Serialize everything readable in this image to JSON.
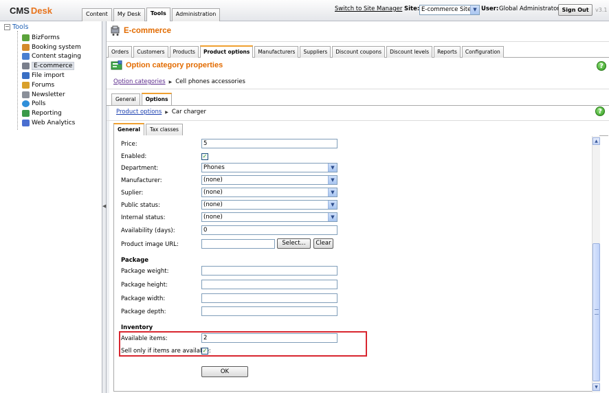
{
  "header": {
    "logo_cms": "CMS",
    "logo_desk": "Desk",
    "tabs": [
      {
        "label": "Content",
        "active": false
      },
      {
        "label": "My Desk",
        "active": false
      },
      {
        "label": "Tools",
        "active": true
      },
      {
        "label": "Administration",
        "active": false
      }
    ],
    "switch_link": "Switch to Site Manager",
    "site_label": "Site:",
    "site_value": "E-commerce Site",
    "user_label": "User:",
    "user_name": "Global Administrator",
    "sign_out": "Sign Out",
    "version": "v3.1"
  },
  "tree": {
    "root": "Tools",
    "items": [
      {
        "label": "BizForms",
        "icon": "bizforms-icon",
        "color": "#5ba33b",
        "selected": false
      },
      {
        "label": "Booking system",
        "icon": "booking-icon",
        "color": "#d48a2a",
        "selected": false
      },
      {
        "label": "Content staging",
        "icon": "staging-icon",
        "color": "#4a7fd0",
        "selected": false
      },
      {
        "label": "E-commerce",
        "icon": "ecommerce-icon",
        "color": "#7a7f8c",
        "selected": true
      },
      {
        "label": "File import",
        "icon": "file-import-icon",
        "color": "#3a6fc4",
        "selected": false
      },
      {
        "label": "Forums",
        "icon": "forums-icon",
        "color": "#d9a02a",
        "selected": false
      },
      {
        "label": "Newsletter",
        "icon": "newsletter-icon",
        "color": "#8a8f99",
        "selected": false
      },
      {
        "label": "Polls",
        "icon": "polls-icon",
        "color": "#2f8fd9",
        "selected": false
      },
      {
        "label": "Reporting",
        "icon": "reporting-icon",
        "color": "#3a9a4a",
        "selected": false
      },
      {
        "label": "Web Analytics",
        "icon": "web-analytics-icon",
        "color": "#4a6fd0",
        "selected": false
      }
    ]
  },
  "module": {
    "title": "E-commerce",
    "tabs": [
      {
        "label": "Orders",
        "active": false
      },
      {
        "label": "Customers",
        "active": false
      },
      {
        "label": "Products",
        "active": false
      },
      {
        "label": "Product options",
        "active": true
      },
      {
        "label": "Manufacturers",
        "active": false
      },
      {
        "label": "Suppliers",
        "active": false
      },
      {
        "label": "Discount coupons",
        "active": false
      },
      {
        "label": "Discount levels",
        "active": false
      },
      {
        "label": "Reports",
        "active": false
      },
      {
        "label": "Configuration",
        "active": false
      }
    ]
  },
  "page": {
    "title": "Option category properties",
    "breadcrumb_link": "Option categories",
    "breadcrumb_current": "Cell phones accessories",
    "sub_tabs": [
      {
        "label": "General",
        "active": false
      },
      {
        "label": "Options",
        "active": true
      }
    ],
    "breadcrumb2_link": "Product options",
    "breadcrumb2_current": "Car charger",
    "form_tabs": [
      {
        "label": "General",
        "active": true
      },
      {
        "label": "Tax classes",
        "active": false
      }
    ]
  },
  "form": {
    "price_label": "Price:",
    "price_value": "5",
    "enabled_label": "Enabled:",
    "enabled_checked": true,
    "department_label": "Department:",
    "department_value": "Phones",
    "manufacturer_label": "Manufacturer:",
    "manufacturer_value": "(none)",
    "supplier_label": "Suplier:",
    "supplier_value": "(none)",
    "public_status_label": "Public status:",
    "public_status_value": "(none)",
    "internal_status_label": "Internal status:",
    "internal_status_value": "(none)",
    "availability_label": "Availability (days):",
    "availability_value": "0",
    "image_url_label": "Product image URL:",
    "image_url_value": "",
    "select_button": "Select...",
    "clear_button": "Clear",
    "package_section": "Package",
    "package_weight_label": "Package weight:",
    "package_height_label": "Package height:",
    "package_width_label": "Package width:",
    "package_depth_label": "Package depth:",
    "inventory_section": "Inventory",
    "available_items_label": "Available items:",
    "available_items_value": "2",
    "sell_only_label": "Sell only if items are available:",
    "sell_only_checked": true,
    "ok_button": "OK"
  },
  "colors": {
    "accent_orange": "#e26b00",
    "highlight_red": "#d8252e",
    "link_blue": "#1a3fb0"
  }
}
